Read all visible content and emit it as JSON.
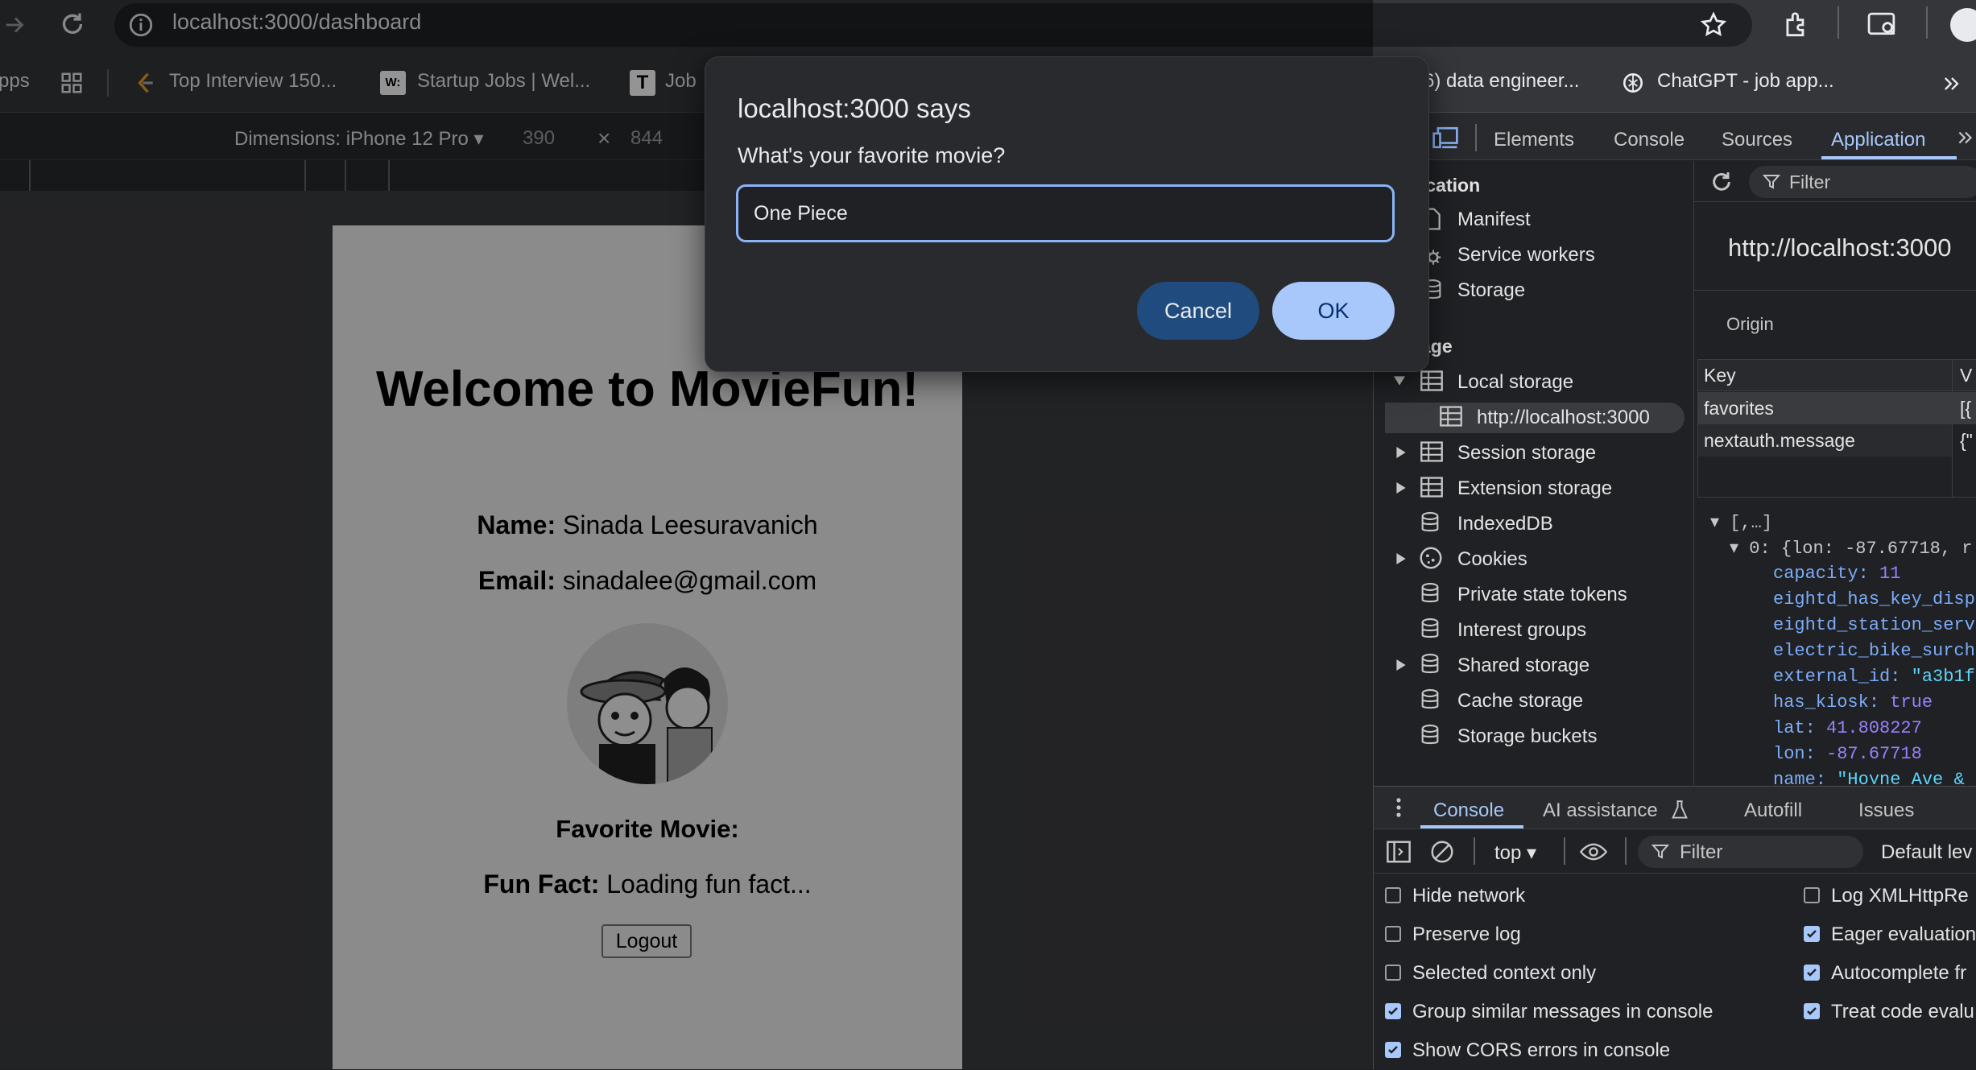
{
  "browser": {
    "url": "localhost:3000/dashboard",
    "bookmarks": [
      {
        "label": "pps"
      },
      {
        "label": "Top Interview 150..."
      },
      {
        "label": "Startup Jobs | Wel..."
      },
      {
        "label": "Job"
      },
      {
        "label": "6) data engineer..."
      },
      {
        "label": "ChatGPT - job app..."
      }
    ]
  },
  "device_toolbar": {
    "dimensions_label": "Dimensions: iPhone 12 Pro ▾",
    "width": "390",
    "times": "×",
    "height": "844"
  },
  "page": {
    "title": "Welcome to MovieFun!",
    "name_label": "Name:",
    "name_value": "Sinada Leesuravanich",
    "email_label": "Email:",
    "email_value": "sinadalee@gmail.com",
    "favorite_label": "Favorite Movie:",
    "funfact_label": "Fun Fact:",
    "funfact_value": "Loading fun fact...",
    "logout": "Logout"
  },
  "dialog": {
    "title": "localhost:3000 says",
    "message": "What's your favorite movie?",
    "input_value": "One Piece",
    "cancel": "Cancel",
    "ok": "OK"
  },
  "devtools": {
    "tabs": [
      "Elements",
      "Console",
      "Sources",
      "Application"
    ],
    "active_tab": "Application",
    "sidebar": {
      "app_header": "ication",
      "app_items": [
        "Manifest",
        "Service workers",
        "Storage"
      ],
      "storage_header": "age",
      "storage_items": [
        "Local storage",
        "http://localhost:3000",
        "Session storage",
        "Extension storage",
        "IndexedDB",
        "Cookies",
        "Private state tokens",
        "Interest groups",
        "Shared storage",
        "Cache storage",
        "Storage buckets"
      ]
    },
    "main": {
      "filter_placeholder": "Filter",
      "origin_url": "http://localhost:3000",
      "origin_label": "Origin",
      "table_headers": [
        "Key",
        "V"
      ],
      "rows": [
        {
          "key": "favorites",
          "value": "[{"
        },
        {
          "key": "nextauth.message",
          "value": "{\""
        }
      ],
      "json_lines": [
        {
          "key": "▾ [,…]",
          "val": ""
        },
        {
          "key": "▾ 0: {lon: -87.67718, r",
          "val": ""
        },
        {
          "key": "capacity:",
          "val": " 11"
        },
        {
          "key": "eightd_has_key_disp",
          "val": ""
        },
        {
          "key": "eightd_station_serv",
          "val": ""
        },
        {
          "key": "electric_bike_surch",
          "val": ""
        },
        {
          "key": "external_id:",
          "val": " \"a3b1f"
        },
        {
          "key": "has_kiosk:",
          "val": " true"
        },
        {
          "key": "lat:",
          "val": " 41.808227"
        },
        {
          "key": "lon:",
          "val": " -87.67718"
        },
        {
          "key": "name:",
          "val": " \"Hoyne Ave &"
        }
      ]
    },
    "drawer": {
      "tabs": [
        "Console",
        "AI assistance",
        "Autofill",
        "Issues"
      ],
      "context": "top ▾",
      "filter_placeholder": "Filter",
      "levels": "Default lev",
      "options_left": [
        {
          "label": "Hide network",
          "checked": false
        },
        {
          "label": "Preserve log",
          "checked": false
        },
        {
          "label": "Selected context only",
          "checked": false
        },
        {
          "label": "Group similar messages in console",
          "checked": true
        },
        {
          "label": "Show CORS errors in console",
          "checked": true
        }
      ],
      "options_right": [
        {
          "label": "Log XMLHttpRe",
          "checked": false
        },
        {
          "label": "Eager evaluation",
          "checked": true
        },
        {
          "label": "Autocomplete fr",
          "checked": true
        },
        {
          "label": "Treat code evalu",
          "checked": true
        }
      ]
    }
  },
  "colors": {
    "accent": "#a8c7fa",
    "link_blue": "#8ab4f8",
    "cancel_bg": "#1f4b7e"
  }
}
